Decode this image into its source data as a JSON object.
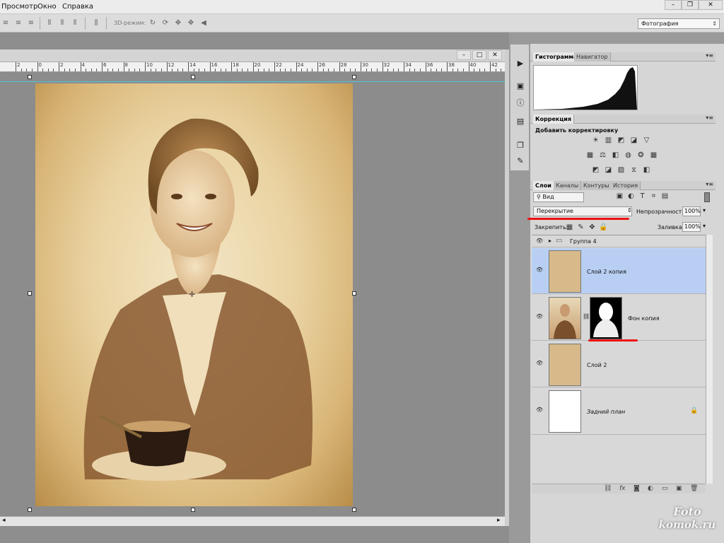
{
  "menu": {
    "items": [
      "Просмотр",
      "Окно",
      "Справка"
    ]
  },
  "window_controls": {
    "minimize": "–",
    "maximize": "❐",
    "close": "✕"
  },
  "options_bar": {
    "mode_3d_label": "3D-режим:",
    "workspace": "Фотография"
  },
  "document": {
    "controls": {
      "minimize": "–",
      "maximize": "□",
      "close": "✕"
    }
  },
  "ruler": {
    "ticks": [
      "2",
      "0",
      "2",
      "4",
      "6",
      "8",
      "10",
      "12",
      "14",
      "16",
      "18",
      "20",
      "22",
      "24",
      "26",
      "28",
      "30",
      "32",
      "34",
      "36",
      "38",
      "40",
      "42"
    ]
  },
  "histogram": {
    "tabs": [
      "Гистограмма",
      "Навигатор"
    ]
  },
  "adjustments": {
    "tab": "Коррекция",
    "title": "Добавить корректировку"
  },
  "layers_panel": {
    "tabs": [
      "Слои",
      "Каналы",
      "Контуры",
      "История"
    ],
    "filter_kind": "Вид",
    "blend_mode": "Перекрытие",
    "opacity_label": "Непрозрачность:",
    "opacity_value": "100%",
    "lock_label": "Закрепить:",
    "fill_label": "Заливка:",
    "fill_value": "100%",
    "layers": [
      {
        "name": "Группа 4",
        "type": "group"
      },
      {
        "name": "Слой 2 копия",
        "selected": true
      },
      {
        "name": "Фон копия",
        "has_mask": true
      },
      {
        "name": "Слой 2"
      },
      {
        "name": "Задний план",
        "locked": true
      }
    ]
  },
  "watermark": {
    "line1": "Foto",
    "line2": "komok.ru"
  },
  "colors": {
    "accent_selected": "#b8cff3",
    "annotation_red": "#e11111"
  }
}
